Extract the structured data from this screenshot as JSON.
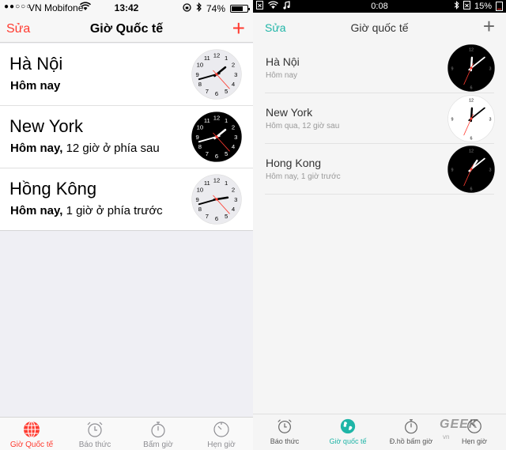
{
  "left": {
    "status": {
      "carrier": "VN Mobifone",
      "time": "13:42",
      "battery": "74%",
      "battery_level": 0.74
    },
    "nav": {
      "edit": "Sửa",
      "title": "Giờ Quốc tế",
      "add": "+"
    },
    "rows": [
      {
        "city": "Hà Nội",
        "day": "Hôm nay",
        "offset": "",
        "theme": "light",
        "h": 1,
        "m": 42,
        "s": 23
      },
      {
        "city": "New York",
        "day": "Hôm nay,",
        "offset": " 12 giờ ở phía sau",
        "theme": "dark",
        "h": 1,
        "m": 42,
        "s": 23
      },
      {
        "city": "Hồng Kông",
        "day": "Hôm nay,",
        "offset": " 1 giờ ở phía trước",
        "theme": "light",
        "h": 2,
        "m": 42,
        "s": 23
      }
    ],
    "tabs": [
      {
        "label": "Giờ Quốc tế",
        "icon": "globe-icon",
        "active": true
      },
      {
        "label": "Báo thức",
        "icon": "alarm-clock-icon",
        "active": false
      },
      {
        "label": "Bấm giờ",
        "icon": "stopwatch-icon",
        "active": false
      },
      {
        "label": "Hẹn giờ",
        "icon": "timer-icon",
        "active": false
      }
    ],
    "accent": "#ff3b30"
  },
  "right": {
    "status": {
      "time": "0:08",
      "battery": "15%",
      "battery_level": 0.15
    },
    "nav": {
      "edit": "Sửa",
      "title": "Giờ quốc tế",
      "add": "+"
    },
    "rows": [
      {
        "city": "Hà Nội",
        "sub": "Hôm nay",
        "theme": "dark",
        "h": 0,
        "m": 8,
        "s": 34
      },
      {
        "city": "New York",
        "sub": "Hôm qua, 12 giờ sau",
        "theme": "light",
        "h": 12,
        "m": 8,
        "s": 34
      },
      {
        "city": "Hong Kong",
        "sub": "Hôm nay, 1 giờ trước",
        "theme": "dark",
        "h": 1,
        "m": 8,
        "s": 34
      }
    ],
    "tabs": [
      {
        "label": "Báo thức",
        "icon": "alarm-clock-icon",
        "active": false
      },
      {
        "label": "Giờ quốc tế",
        "icon": "globe-icon",
        "active": true
      },
      {
        "label": "Đ.hồ bấm giờ",
        "icon": "stopwatch-icon",
        "active": false
      },
      {
        "label": "Hẹn giờ",
        "icon": "timer-icon",
        "active": false
      }
    ],
    "accent": "#1fb5a7"
  },
  "watermark": {
    "brand": "GEEK",
    "sub": "vn"
  }
}
